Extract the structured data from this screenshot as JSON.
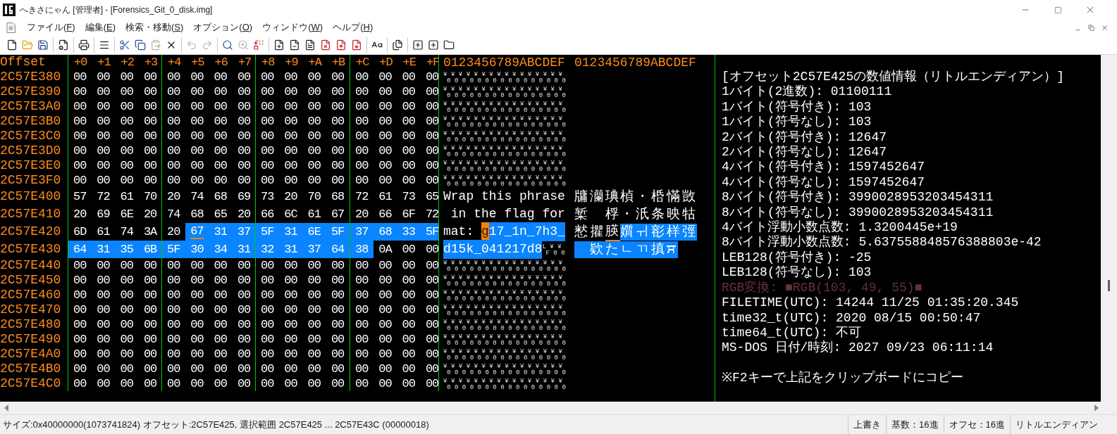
{
  "window": {
    "title": "へきさにゃん [管理者] - [Forensics_Git_0_disk.img]"
  },
  "menu": [
    "ファイル(F)",
    "編集(E)",
    "検索・移動(S)",
    "オプション(O)",
    "ウィンドウ(W)",
    "ヘルプ(H)"
  ],
  "toolbar": [
    [
      {
        "disabled": false
      },
      {
        "disabled": false
      },
      {
        "disabled": false
      }
    ],
    [
      {
        "disabled": false
      }
    ],
    [
      {
        "disabled": false
      }
    ],
    [
      {
        "disabled": false
      }
    ],
    [
      {
        "disabled": false
      },
      {
        "disabled": false
      },
      {
        "disabled": true
      },
      {
        "disabled": false
      }
    ],
    [
      {
        "disabled": true
      },
      {
        "disabled": true
      }
    ],
    [
      {
        "disabled": false
      },
      {
        "disabled": true
      },
      {
        "disabled": false
      }
    ],
    [
      {
        "disabled": false
      },
      {
        "disabled": false
      },
      {
        "disabled": false
      },
      {
        "disabled": false
      },
      {
        "disabled": false
      },
      {
        "disabled": false
      }
    ],
    [
      {
        "disabled": false
      }
    ],
    [
      {
        "disabled": false
      }
    ],
    [
      {
        "disabled": false
      },
      {
        "disabled": false
      },
      {
        "disabled": false
      }
    ]
  ],
  "header": {
    "offset": "Offset",
    "columns": [
      "+0",
      "+1",
      "+2",
      "+3",
      "+4",
      "+5",
      "+6",
      "+7",
      "+8",
      "+9",
      "+A",
      "+B",
      "+C",
      "+D",
      "+E",
      "+F"
    ],
    "text_1": "0123456789ABCDEF",
    "text_2": "0123456789ABCDEF"
  },
  "rows": [
    {
      "offset": "2C57E380",
      "hex": [
        {
          "bytes": "00 00 00 00 00 00 00 00 00 00 00 00 00 00 00 00",
          "selected": false
        }
      ],
      "ascii": [
        {
          "kind": "ctrl",
          "top": "¥ ¥ ¥ ¥ ¥ ¥ ¥ ¥ ¥ ¥ ¥ ¥ ¥ ¥ ¥ ¥",
          "bottom": "0 0 0 0 0 0 0 0 0 0 0 0 0 0 0 0"
        }
      ]
    },
    {
      "offset": "2C57E390",
      "hex": [
        {
          "bytes": "00 00 00 00 00 00 00 00 00 00 00 00 00 00 00 00",
          "selected": false
        }
      ],
      "ascii": [
        {
          "kind": "ctrl",
          "top": "¥ ¥ ¥ ¥ ¥ ¥ ¥ ¥ ¥ ¥ ¥ ¥ ¥ ¥ ¥ ¥",
          "bottom": "0 0 0 0 0 0 0 0 0 0 0 0 0 0 0 0"
        }
      ]
    },
    {
      "offset": "2C57E3A0",
      "hex": [
        {
          "bytes": "00 00 00 00 00 00 00 00 00 00 00 00 00 00 00 00",
          "selected": false
        }
      ],
      "ascii": [
        {
          "kind": "ctrl",
          "top": "¥ ¥ ¥ ¥ ¥ ¥ ¥ ¥ ¥ ¥ ¥ ¥ ¥ ¥ ¥ ¥",
          "bottom": "0 0 0 0 0 0 0 0 0 0 0 0 0 0 0 0"
        }
      ]
    },
    {
      "offset": "2C57E3B0",
      "hex": [
        {
          "bytes": "00 00 00 00 00 00 00 00 00 00 00 00 00 00 00 00",
          "selected": false
        }
      ],
      "ascii": [
        {
          "kind": "ctrl",
          "top": "¥ ¥ ¥ ¥ ¥ ¥ ¥ ¥ ¥ ¥ ¥ ¥ ¥ ¥ ¥ ¥",
          "bottom": "0 0 0 0 0 0 0 0 0 0 0 0 0 0 0 0"
        }
      ]
    },
    {
      "offset": "2C57E3C0",
      "hex": [
        {
          "bytes": "00 00 00 00 00 00 00 00 00 00 00 00 00 00 00 00",
          "selected": false
        }
      ],
      "ascii": [
        {
          "kind": "ctrl",
          "top": "¥ ¥ ¥ ¥ ¥ ¥ ¥ ¥ ¥ ¥ ¥ ¥ ¥ ¥ ¥ ¥",
          "bottom": "0 0 0 0 0 0 0 0 0 0 0 0 0 0 0 0"
        }
      ]
    },
    {
      "offset": "2C57E3D0",
      "hex": [
        {
          "bytes": "00 00 00 00 00 00 00 00 00 00 00 00 00 00 00 00",
          "selected": false
        }
      ],
      "ascii": [
        {
          "kind": "ctrl",
          "top": "¥ ¥ ¥ ¥ ¥ ¥ ¥ ¥ ¥ ¥ ¥ ¥ ¥ ¥ ¥ ¥",
          "bottom": "0 0 0 0 0 0 0 0 0 0 0 0 0 0 0 0"
        }
      ]
    },
    {
      "offset": "2C57E3E0",
      "hex": [
        {
          "bytes": "00 00 00 00 00 00 00 00 00 00 00 00 00 00 00 00",
          "selected": false
        }
      ],
      "ascii": [
        {
          "kind": "ctrl",
          "top": "¥ ¥ ¥ ¥ ¥ ¥ ¥ ¥ ¥ ¥ ¥ ¥ ¥ ¥ ¥ ¥",
          "bottom": "0 0 0 0 0 0 0 0 0 0 0 0 0 0 0 0"
        }
      ]
    },
    {
      "offset": "2C57E3F0",
      "hex": [
        {
          "bytes": "00 00 00 00 00 00 00 00 00 00 00 00 00 00 00 00",
          "selected": false
        }
      ],
      "ascii": [
        {
          "kind": "ctrl",
          "top": "¥ ¥ ¥ ¥ ¥ ¥ ¥ ¥ ¥ ¥ ¥ ¥ ¥ ¥ ¥ ¥",
          "bottom": "0 0 0 0 0 0 0 0 0 0 0 0 0 0 0 0"
        }
      ]
    },
    {
      "offset": "2C57E400",
      "hex": [
        {
          "bytes": "57 72 61 70 20 74 68 69 73 20 70 68 72 61 73 65",
          "selected": false,
          "cursor": false
        }
      ],
      "ascii": [
        {
          "kind": "text",
          "text": "Wrap this phrase",
          "selected": false,
          "cursor": false
        }
      ],
      "text_2": [
        {
          "text": "牗灡琠楨・桰慲敳",
          "selected": false,
          "cursor": false
        }
      ]
    },
    {
      "offset": "2C57E410",
      "hex": [
        {
          "bytes": "20 69 6E 20 74 68 65 20 66 6C 61 67 20 66 6F 72",
          "selected": false,
          "cursor": false
        }
      ],
      "ascii": [
        {
          "kind": "text",
          "text": " in the flag for",
          "selected": false,
          "cursor": false
        }
      ],
      "text_2": [
        {
          "text": "椠　桴・汦条映牯",
          "selected": false,
          "cursor": false
        }
      ]
    },
    {
      "offset": "2C57E420",
      "hex": [
        {
          "bytes": "6D 61 74 3A 20",
          "selected": false,
          "cursor": false
        },
        {
          "bytes": "67",
          "selected": true,
          "cursor": true
        },
        {
          "bytes": "31 37 5F 31 6E 5F 37 68 33 5F",
          "selected": true,
          "cursor": false
        }
      ],
      "ascii": [
        {
          "kind": "text",
          "text": "mat: ",
          "selected": false,
          "cursor": false
        },
        {
          "kind": "text",
          "text": "g",
          "selected": true,
          "cursor": true
        },
        {
          "kind": "text",
          "text": "17_1n_7h3_",
          "selected": true,
          "cursor": false
        }
      ],
      "text_2": [
        {
          "text": "慭㩴",
          "selected": false,
          "cursor": false
        },
        {
          "text": "朠",
          "selected": false,
          "cursor": true
        },
        {
          "text": "㜱ㅟ彮样弳",
          "selected": true,
          "cursor": false
        }
      ]
    },
    {
      "offset": "2C57E430",
      "hex": [
        {
          "bytes": "64 31 35 6B 5F 30 34 31 32 31 37 64 38",
          "selected": true,
          "cursor": false
        },
        {
          "bytes": "0A 00 00",
          "selected": false,
          "cursor": false
        }
      ],
      "ascii": [
        {
          "kind": "text",
          "text": "d15k_041217d8",
          "selected": true,
          "cursor": false
        },
        {
          "kind": "ctrl",
          "top": "L ¥ ¥",
          "bottom": "F 0 0"
        }
      ],
      "text_2": [
        {
          "text": "　欵たㄴㄲ搷ਸ",
          "selected": true,
          "cursor": false
        }
      ]
    },
    {
      "offset": "2C57E440",
      "hex": [
        {
          "bytes": "00 00 00 00 00 00 00 00 00 00 00 00 00 00 00 00",
          "selected": false
        }
      ],
      "ascii": [
        {
          "kind": "ctrl",
          "top": "¥ ¥ ¥ ¥ ¥ ¥ ¥ ¥ ¥ ¥ ¥ ¥ ¥ ¥ ¥ ¥",
          "bottom": "0 0 0 0 0 0 0 0 0 0 0 0 0 0 0 0"
        }
      ]
    },
    {
      "offset": "2C57E450",
      "hex": [
        {
          "bytes": "00 00 00 00 00 00 00 00 00 00 00 00 00 00 00 00",
          "selected": false
        }
      ],
      "ascii": [
        {
          "kind": "ctrl",
          "top": "¥ ¥ ¥ ¥ ¥ ¥ ¥ ¥ ¥ ¥ ¥ ¥ ¥ ¥ ¥ ¥",
          "bottom": "0 0 0 0 0 0 0 0 0 0 0 0 0 0 0 0"
        }
      ]
    },
    {
      "offset": "2C57E460",
      "hex": [
        {
          "bytes": "00 00 00 00 00 00 00 00 00 00 00 00 00 00 00 00",
          "selected": false
        }
      ],
      "ascii": [
        {
          "kind": "ctrl",
          "top": "¥ ¥ ¥ ¥ ¥ ¥ ¥ ¥ ¥ ¥ ¥ ¥ ¥ ¥ ¥ ¥",
          "bottom": "0 0 0 0 0 0 0 0 0 0 0 0 0 0 0 0"
        }
      ]
    },
    {
      "offset": "2C57E470",
      "hex": [
        {
          "bytes": "00 00 00 00 00 00 00 00 00 00 00 00 00 00 00 00",
          "selected": false
        }
      ],
      "ascii": [
        {
          "kind": "ctrl",
          "top": "¥ ¥ ¥ ¥ ¥ ¥ ¥ ¥ ¥ ¥ ¥ ¥ ¥ ¥ ¥ ¥",
          "bottom": "0 0 0 0 0 0 0 0 0 0 0 0 0 0 0 0"
        }
      ]
    },
    {
      "offset": "2C57E480",
      "hex": [
        {
          "bytes": "00 00 00 00 00 00 00 00 00 00 00 00 00 00 00 00",
          "selected": false
        }
      ],
      "ascii": [
        {
          "kind": "ctrl",
          "top": "¥ ¥ ¥ ¥ ¥ ¥ ¥ ¥ ¥ ¥ ¥ ¥ ¥ ¥ ¥ ¥",
          "bottom": "0 0 0 0 0 0 0 0 0 0 0 0 0 0 0 0"
        }
      ]
    },
    {
      "offset": "2C57E490",
      "hex": [
        {
          "bytes": "00 00 00 00 00 00 00 00 00 00 00 00 00 00 00 00",
          "selected": false
        }
      ],
      "ascii": [
        {
          "kind": "ctrl",
          "top": "¥ ¥ ¥ ¥ ¥ ¥ ¥ ¥ ¥ ¥ ¥ ¥ ¥ ¥ ¥ ¥",
          "bottom": "0 0 0 0 0 0 0 0 0 0 0 0 0 0 0 0"
        }
      ]
    },
    {
      "offset": "2C57E4A0",
      "hex": [
        {
          "bytes": "00 00 00 00 00 00 00 00 00 00 00 00 00 00 00 00",
          "selected": false
        }
      ],
      "ascii": [
        {
          "kind": "ctrl",
          "top": "¥ ¥ ¥ ¥ ¥ ¥ ¥ ¥ ¥ ¥ ¥ ¥ ¥ ¥ ¥ ¥",
          "bottom": "0 0 0 0 0 0 0 0 0 0 0 0 0 0 0 0"
        }
      ]
    },
    {
      "offset": "2C57E4B0",
      "hex": [
        {
          "bytes": "00 00 00 00 00 00 00 00 00 00 00 00 00 00 00 00",
          "selected": false
        }
      ],
      "ascii": [
        {
          "kind": "ctrl",
          "top": "¥ ¥ ¥ ¥ ¥ ¥ ¥ ¥ ¥ ¥ ¥ ¥ ¥ ¥ ¥ ¥",
          "bottom": "0 0 0 0 0 0 0 0 0 0 0 0 0 0 0 0"
        }
      ]
    },
    {
      "offset": "2C57E4C0",
      "hex": [
        {
          "bytes": "00 00 00 00 00 00 00 00 00 00 00 00 00 00 00 00",
          "selected": false
        }
      ],
      "ascii": [
        {
          "kind": "ctrl",
          "top": "¥ ¥ ¥ ¥ ¥ ¥ ¥ ¥ ¥ ¥ ¥ ¥ ¥ ¥ ¥ ¥",
          "bottom": "0 0 0 0 0 0 0 0 0 0 0 0 0 0 0 0"
        }
      ]
    }
  ],
  "info": [
    {
      "kind": "plain",
      "text": "[オフセット2C57E425の数値情報（リトルエンディアン）]"
    },
    {
      "kind": "plain",
      "text": "1バイト(2進数): 01100111"
    },
    {
      "kind": "plain",
      "text": "1バイト(符号付き): 103"
    },
    {
      "kind": "plain",
      "text": "1バイト(符号なし): 103"
    },
    {
      "kind": "plain",
      "text": "2バイト(符号付き): 12647"
    },
    {
      "kind": "plain",
      "text": "2バイト(符号なし): 12647"
    },
    {
      "kind": "plain",
      "text": "4バイト(符号付き): 1597452647"
    },
    {
      "kind": "plain",
      "text": "4バイト(符号なし): 1597452647"
    },
    {
      "kind": "plain",
      "text": "8バイト(符号付き): 3990028953203454311"
    },
    {
      "kind": "plain",
      "text": "8バイト(符号なし): 3990028953203454311"
    },
    {
      "kind": "plain",
      "text": "4バイト浮動小数点数: 1.3200445e+19"
    },
    {
      "kind": "plain",
      "text": "8バイト浮動小数点数: 5.637558848576388803e-42"
    },
    {
      "kind": "plain",
      "text": "LEB128(符号付き): -25"
    },
    {
      "kind": "plain",
      "text": "LEB128(符号なし): 103"
    },
    {
      "kind": "rgb",
      "text": "RGB変換: ■RGB(103, 49, 55)■",
      "color": "#673137"
    },
    {
      "kind": "plain",
      "text": "FILETIME(UTC): 14244 11/25 01:35:20.345"
    },
    {
      "kind": "plain",
      "text": "time32_t(UTC): 2020 08/15 00:50:47"
    },
    {
      "kind": "plain",
      "text": "time64_t(UTC): 不可"
    },
    {
      "kind": "plain",
      "text": "MS-DOS 日付/時刻: 2027 09/23 06:11:14"
    },
    {
      "kind": "note",
      "text": "※F2キーで上記をクリップボードにコピー"
    }
  ],
  "status_bar": {
    "text": "サイズ:0x40000000(1073741824) オフセット:2C57E425, 選択範囲 2C57E425 ... 2C57E43C (00000018)",
    "panes": [
      "上書き",
      "基数：16進",
      "オフセ：16進",
      "リトルエンディアン"
    ]
  }
}
